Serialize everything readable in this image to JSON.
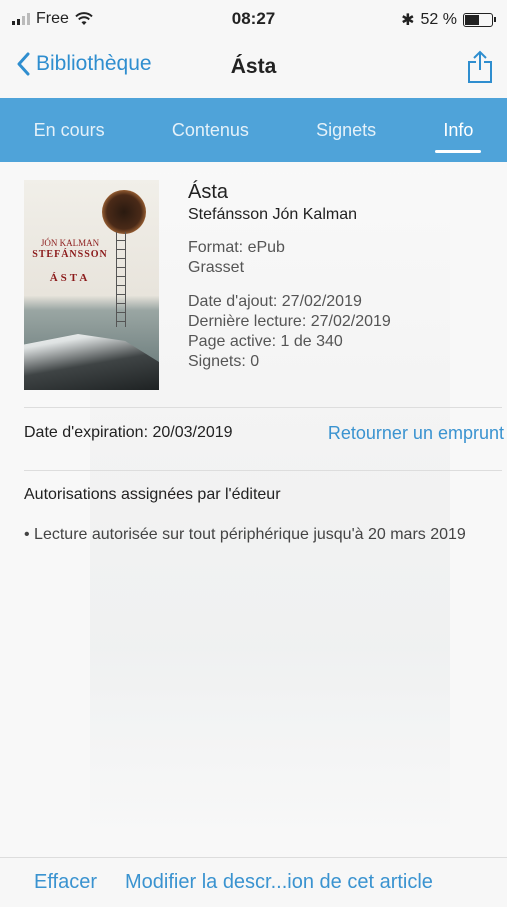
{
  "status_bar": {
    "carrier": "Free",
    "time": "08:27",
    "battery_text": "52 %",
    "battery_level": 0.52,
    "bluetooth": "✱"
  },
  "nav": {
    "back_label": "Bibliothèque",
    "title": "Ásta"
  },
  "tabs": [
    {
      "label": "En cours",
      "active": false
    },
    {
      "label": "Contenus",
      "active": false
    },
    {
      "label": "Signets",
      "active": false
    },
    {
      "label": "Info",
      "active": true
    }
  ],
  "book": {
    "title": "Ásta",
    "author": "Stefánsson Jón Kalman",
    "format": "Format: ePub",
    "publisher": "Grasset",
    "date_added": "Date d'ajout: 27/02/2019",
    "last_read": "Dernière lecture: 27/02/2019",
    "active_page": "Page active: 1 de 340",
    "bookmarks": "Signets: 0",
    "cover": {
      "author_line1": "JÓN KALMAN",
      "author_line2": "STEFÁNSSON",
      "title": "ÁSTA"
    }
  },
  "loan": {
    "expiration": "Date d'expiration: 20/03/2019",
    "return_label": "Retourner un emprunt"
  },
  "permissions": {
    "title": "Autorisations assignées par l'éditeur",
    "items": [
      "• Lecture autorisée sur tout périphérique jusqu'à 20 mars 2019"
    ]
  },
  "bottom": {
    "delete_label": "Effacer",
    "edit_label": "Modifier la descr...ion de cet article"
  },
  "colors": {
    "accent": "#4fa3d9",
    "link": "#3a93d0"
  }
}
